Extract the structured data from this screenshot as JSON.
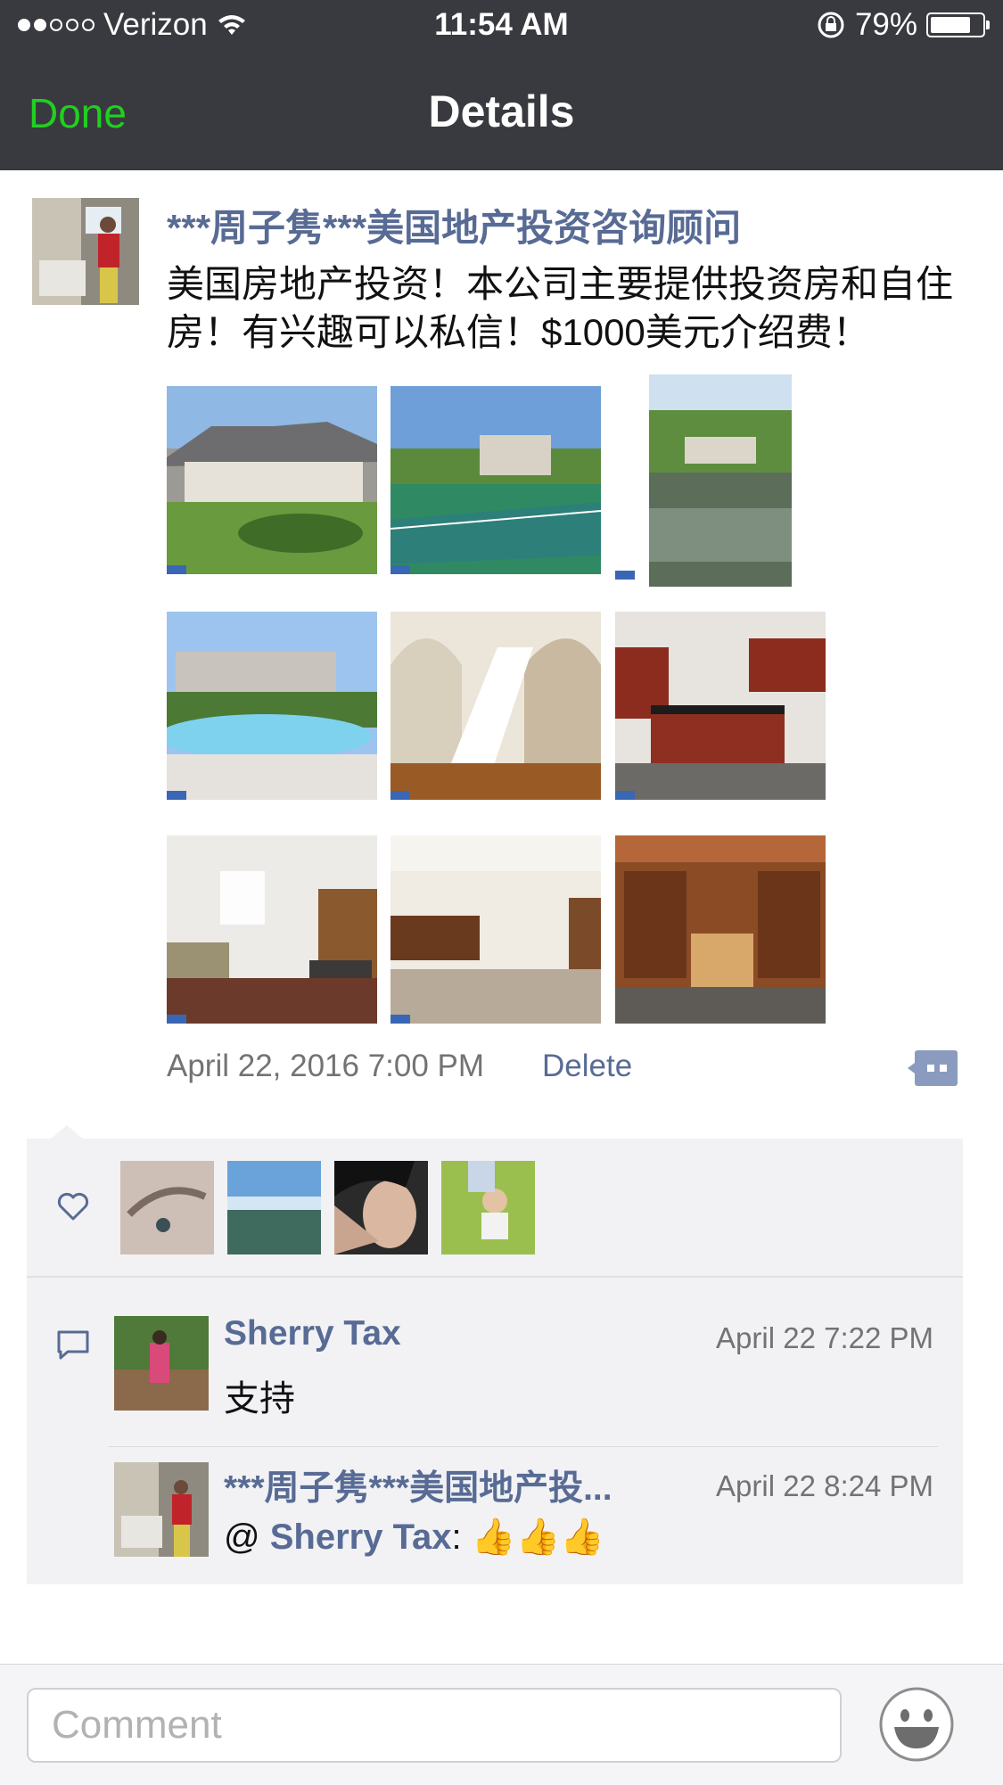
{
  "status_bar": {
    "carrier": "Verizon",
    "time": "11:54 AM",
    "battery": "79%",
    "battery_level": 0.79,
    "icons": [
      "signal-dots-icon",
      "wifi-icon",
      "rotation-lock-icon",
      "battery-icon"
    ]
  },
  "nav": {
    "done_label": "Done",
    "title": "Details"
  },
  "post": {
    "author": "***周子隽***美国地产投资咨询顾问",
    "text": "美国房地产投资！本公司主要提供投资房和自住房！有兴趣可以私信！$1000美元介绍费！",
    "photos": [
      "house-exterior",
      "tennis-court",
      "pond-view",
      "swimming-pool",
      "staircase",
      "kitchen",
      "living-room",
      "basement-bar",
      "wine-cellar"
    ],
    "timestamp": "April 22, 2016 7:00 PM",
    "delete_label": "Delete"
  },
  "likes": {
    "icon": "heart-icon",
    "avatars": [
      "liker-avatar-1",
      "liker-avatar-2",
      "liker-avatar-3",
      "liker-avatar-4"
    ]
  },
  "comments": [
    {
      "author": "Sherry Tax",
      "time": "April 22 7:22 PM",
      "text": "支持"
    },
    {
      "author": "***周子隽***美国地产投...",
      "time": "April 22 8:24 PM",
      "mention_prefix": "@ ",
      "mention": "Sherry Tax",
      "suffix": ": ",
      "emoji": "👍👍👍"
    }
  ],
  "composer": {
    "placeholder": "Comment",
    "emoji_icon": "smiley-face-icon"
  },
  "colors": {
    "nav_bg": "#393a3f",
    "done_green": "#20d020",
    "link_blue": "#586b95",
    "box_bg": "#f2f2f4"
  }
}
